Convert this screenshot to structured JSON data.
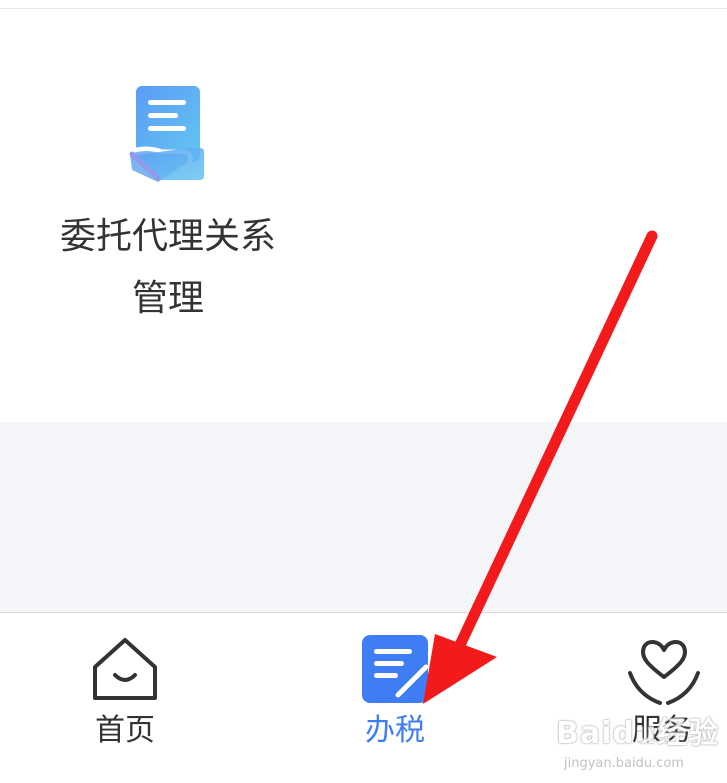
{
  "service": {
    "label_line1": "委托代理关系",
    "label_line2": "管理",
    "icon": "document-hand-icon"
  },
  "tabbar": {
    "tabs": [
      {
        "label": "首页",
        "icon": "home-icon",
        "active": false
      },
      {
        "label": "办税",
        "icon": "tax-document-icon",
        "active": true
      },
      {
        "label": "服务",
        "icon": "heart-hands-icon",
        "active": false
      }
    ]
  },
  "watermark": {
    "logo": "Baidu经验",
    "url": "jingyan.baidu.com"
  },
  "colors": {
    "accent_blue": "#3f7df5",
    "annotation_red": "#f21a1a",
    "text_dark": "#333333",
    "band_gray": "#f4f5f9"
  }
}
